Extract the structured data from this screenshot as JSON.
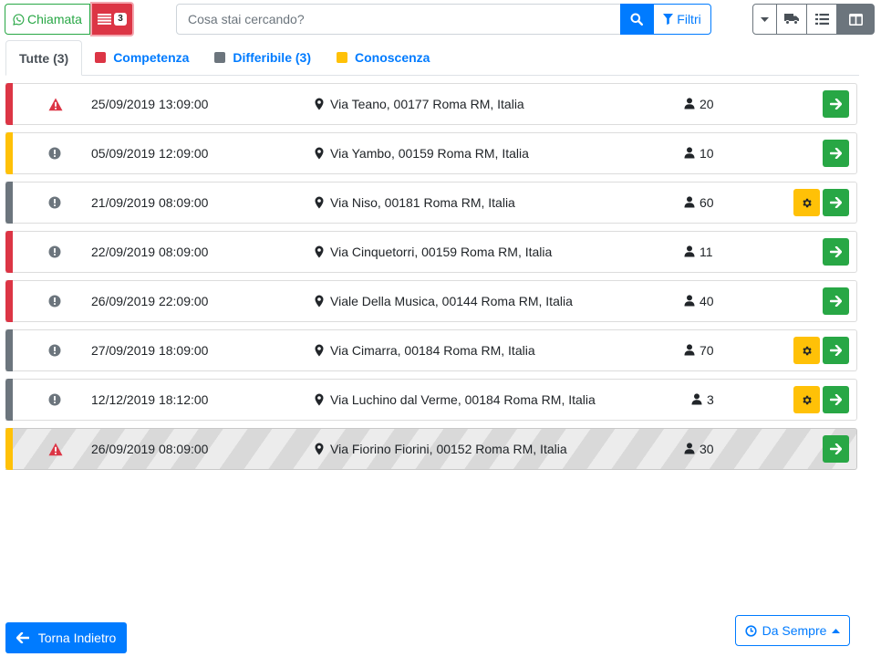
{
  "toolbar": {
    "chiamata_label": "Chiamata",
    "list_badge": "3",
    "search_placeholder": "Cosa stai cercando?",
    "filters_label": "Filtri"
  },
  "tabs": [
    {
      "label": "Tutte (3)",
      "active": true
    },
    {
      "label": "Competenza",
      "color": "#dc3545"
    },
    {
      "label": "Differibile (3)",
      "color": "#6c757d"
    },
    {
      "label": "Conoscenza",
      "color": "#ffc107"
    }
  ],
  "colors": {
    "red": "#dc3545",
    "yellow": "#ffc107",
    "gray": "#6c757d",
    "green": "#28a745",
    "blue": "#007bff"
  },
  "rows": [
    {
      "stripe": "red",
      "priority": "warning-triangle-icon",
      "date": "25/09/2019 13:09:00",
      "address": "Via Teano, 00177 Roma RM, Italia",
      "people": "20",
      "gear": false
    },
    {
      "stripe": "yellow",
      "priority": "exclamation-circle-icon",
      "date": "05/09/2019 12:09:00",
      "address": "Via Yambo, 00159 Roma RM, Italia",
      "people": "10",
      "gear": false
    },
    {
      "stripe": "gray",
      "priority": "exclamation-circle-icon",
      "date": "21/09/2019 08:09:00",
      "address": "Via Niso, 00181 Roma RM, Italia",
      "people": "60",
      "gear": true
    },
    {
      "stripe": "red",
      "priority": "exclamation-circle-icon",
      "date": "22/09/2019 08:09:00",
      "address": "Via Cinquetorri, 00159 Roma RM, Italia",
      "people": "11",
      "gear": false
    },
    {
      "stripe": "red",
      "priority": "exclamation-circle-icon",
      "date": "26/09/2019 22:09:00",
      "address": "Viale Della Musica, 00144 Roma RM, Italia",
      "people": "40",
      "gear": false
    },
    {
      "stripe": "gray",
      "priority": "exclamation-circle-icon",
      "date": "27/09/2019 18:09:00",
      "address": "Via Cimarra, 00184 Roma RM, Italia",
      "people": "70",
      "gear": true
    },
    {
      "stripe": "gray",
      "priority": "exclamation-circle-icon",
      "date": "12/12/2019 18:12:00",
      "address": "Via Luchino dal Verme, 00184 Roma RM, Italia",
      "people": "3",
      "gear": true
    },
    {
      "stripe": "yellow",
      "priority": "warning-triangle-icon",
      "date": "26/09/2019 08:09:00",
      "address": "Via Fiorino Fiorini, 00152 Roma RM, Italia",
      "people": "30",
      "gear": false,
      "striped": true
    }
  ],
  "footer": {
    "back_label": "Torna Indietro",
    "period_label": "Da Sempre"
  }
}
